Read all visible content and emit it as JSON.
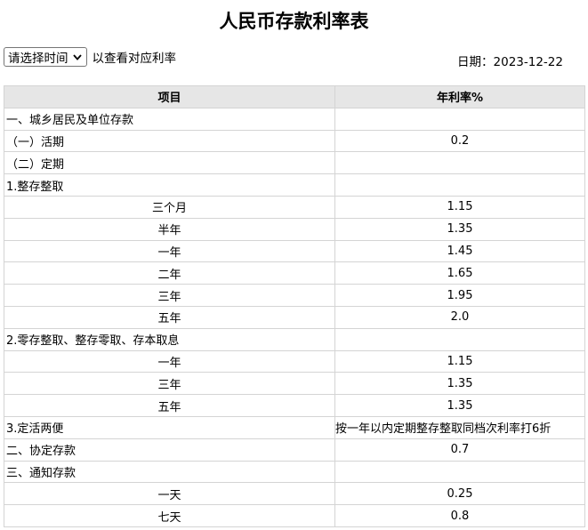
{
  "title": "人民币存款利率表",
  "controls": {
    "select_value": "请选择时间",
    "hint": "以查看对应利率"
  },
  "date": {
    "label": "日期：",
    "value": "2023-12-22"
  },
  "table": {
    "headers": [
      "项目",
      "年利率%"
    ],
    "rows": [
      {
        "item": "一、城乡居民及单位存款",
        "rate": "",
        "align": "left"
      },
      {
        "item": "（一）活期",
        "rate": "0.2",
        "align": "left"
      },
      {
        "item": "（二）定期",
        "rate": "",
        "align": "left"
      },
      {
        "item": "1.整存整取",
        "rate": "",
        "align": "left"
      },
      {
        "item": "三个月",
        "rate": "1.15",
        "align": "center"
      },
      {
        "item": "半年",
        "rate": "1.35",
        "align": "center"
      },
      {
        "item": "一年",
        "rate": "1.45",
        "align": "center"
      },
      {
        "item": "二年",
        "rate": "1.65",
        "align": "center"
      },
      {
        "item": "三年",
        "rate": "1.95",
        "align": "center"
      },
      {
        "item": "五年",
        "rate": "2.0",
        "align": "center"
      },
      {
        "item": "2.零存整取、整存零取、存本取息",
        "rate": "",
        "align": "left"
      },
      {
        "item": "一年",
        "rate": "1.15",
        "align": "center"
      },
      {
        "item": "三年",
        "rate": "1.35",
        "align": "center"
      },
      {
        "item": "五年",
        "rate": "1.35",
        "align": "center"
      },
      {
        "item": "3.定活两便",
        "rate": "按一年以内定期整存整取同档次利率打6折",
        "align": "left"
      },
      {
        "item": "二、协定存款",
        "rate": "0.7",
        "align": "left"
      },
      {
        "item": "三、通知存款",
        "rate": "",
        "align": "left"
      },
      {
        "item": "一天",
        "rate": "0.25",
        "align": "center"
      },
      {
        "item": "七天",
        "rate": "0.8",
        "align": "center"
      }
    ]
  }
}
